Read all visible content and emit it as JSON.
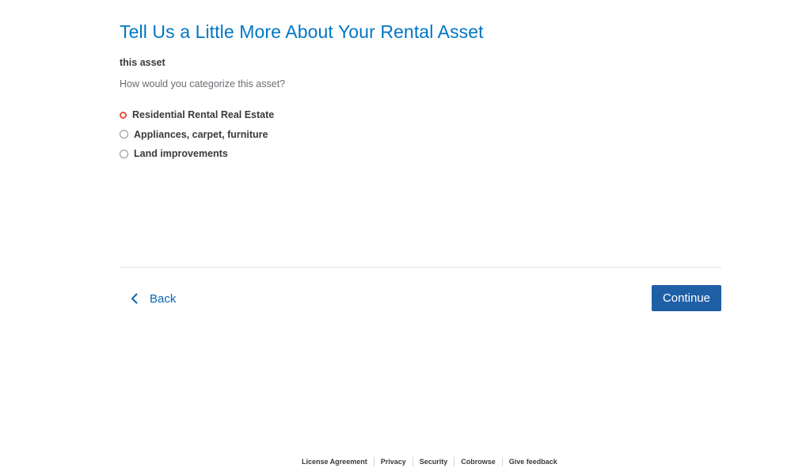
{
  "page": {
    "title": "Tell Us a Little More About Your Rental Asset",
    "subtitle": "this asset",
    "question": "How would you categorize this asset?"
  },
  "options": [
    {
      "label": "Residential Rental Real Estate",
      "selected": true
    },
    {
      "label": "Appliances, carpet, furniture",
      "selected": false
    },
    {
      "label": "Land improvements",
      "selected": false
    }
  ],
  "nav": {
    "back_label": "Back",
    "continue_label": "Continue",
    "back_icon": "chevron-left-icon"
  },
  "footer": {
    "links": [
      "License Agreement",
      "Privacy",
      "Security",
      "Cobrowse",
      "Give feedback"
    ]
  },
  "colors": {
    "title": "#0077c5",
    "primary_button": "#1f5fa6",
    "radio_selected": "#e5533a",
    "link": "#0d66ad"
  }
}
